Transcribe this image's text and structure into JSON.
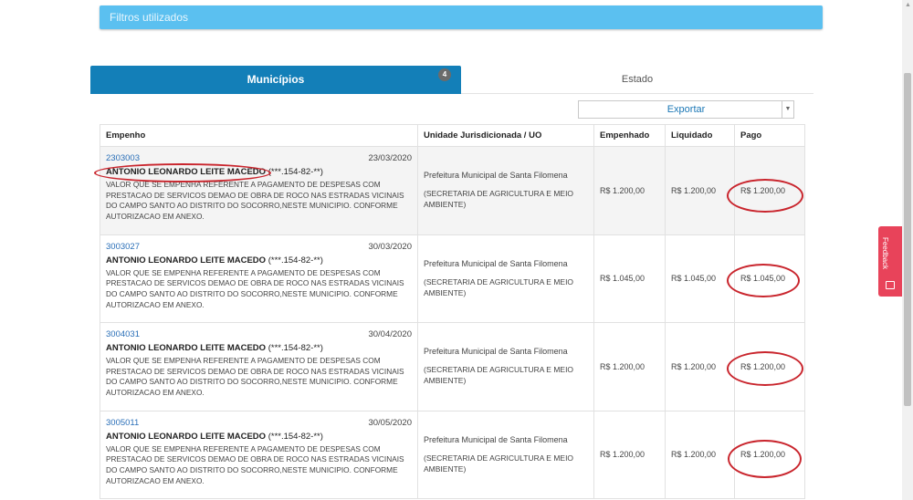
{
  "filters": {
    "label": "Filtros utilizados"
  },
  "tabs": {
    "municipios_label": "Municípios",
    "municipios_count": "4",
    "estado_label": "Estado"
  },
  "export": {
    "label": "Exportar"
  },
  "table": {
    "headers": {
      "empenho": "Empenho",
      "unidade": "Unidade Jurisdicionada / UO",
      "empenhado": "Empenhado",
      "liquidado": "Liquidado",
      "pago": "Pago"
    },
    "rows": [
      {
        "number": "2303003",
        "date": "23/03/2020",
        "name": "ANTONIO LEONARDO LEITE MACEDO",
        "doc": "(***.154-82-**)",
        "desc": "VALOR QUE SE EMPENHA REFERENTE A PAGAMENTO DE DESPESAS COM PRESTACAO DE SERVICOS DEMAO DE OBRA DE ROCO NAS ESTRADAS VICINAIS DO CAMPO SANTO AO DISTRITO DO SOCORRO,NESTE MUNICIPIO. CONFORME AUTORIZACAO EM ANEXO.",
        "uj": "Prefeitura Municipal de Santa Filomena",
        "uo": "(SECRETARIA DE AGRICULTURA E MEIO AMBIENTE)",
        "empenhado": "R$ 1.200,00",
        "liquidado": "R$ 1.200,00",
        "pago": "R$ 1.200,00"
      },
      {
        "number": "3003027",
        "date": "30/03/2020",
        "name": "ANTONIO LEONARDO LEITE MACEDO",
        "doc": "(***.154-82-**)",
        "desc": "VALOR QUE SE EMPENHA REFERENTE A PAGAMENTO DE DESPESAS COM PRESTACAO DE SERVICOS DEMAO DE OBRA DE ROCO NAS ESTRADAS VICINAIS DO CAMPO SANTO AO DISTRITO DO SOCORRO,NESTE MUNICIPIO. CONFORME AUTORIZACAO EM ANEXO.",
        "uj": "Prefeitura Municipal de Santa Filomena",
        "uo": "(SECRETARIA DE AGRICULTURA E MEIO AMBIENTE)",
        "empenhado": "R$ 1.045,00",
        "liquidado": "R$ 1.045,00",
        "pago": "R$ 1.045,00"
      },
      {
        "number": "3004031",
        "date": "30/04/2020",
        "name": "ANTONIO LEONARDO LEITE MACEDO",
        "doc": "(***.154-82-**)",
        "desc": "VALOR QUE SE EMPENHA REFERENTE A PAGAMENTO DE DESPESAS COM PRESTACAO DE SERVICOS DEMAO DE OBRA DE ROCO NAS ESTRADAS VICINAIS DO CAMPO SANTO AO DISTRITO DO SOCORRO,NESTE MUNICIPIO. CONFORME AUTORIZACAO EM ANEXO.",
        "uj": "Prefeitura Municipal de Santa Filomena",
        "uo": "(SECRETARIA DE AGRICULTURA E MEIO AMBIENTE)",
        "empenhado": "R$ 1.200,00",
        "liquidado": "R$ 1.200,00",
        "pago": "R$ 1.200,00"
      },
      {
        "number": "3005011",
        "date": "30/05/2020",
        "name": "ANTONIO LEONARDO LEITE MACEDO",
        "doc": "(***.154-82-**)",
        "desc": "VALOR QUE SE EMPENHA REFERENTE A PAGAMENTO DE DESPESAS COM PRESTACAO DE SERVICOS DEMAO DE OBRA DE ROCO NAS ESTRADAS VICINAIS DO CAMPO SANTO AO DISTRITO DO SOCORRO,NESTE MUNICIPIO. CONFORME AUTORIZACAO EM ANEXO.",
        "uj": "Prefeitura Municipal de Santa Filomena",
        "uo": "(SECRETARIA DE AGRICULTURA E MEIO AMBIENTE)",
        "empenhado": "R$ 1.200,00",
        "liquidado": "R$ 1.200,00",
        "pago": "R$ 1.200,00"
      }
    ]
  },
  "feedback": {
    "label": "Feedback",
    "icon": "feedback-icon"
  },
  "colors": {
    "accent": "#137fb8",
    "filters_bar": "#5bc0f0",
    "annotation": "#c9252d",
    "feedback": "#e8435a"
  }
}
